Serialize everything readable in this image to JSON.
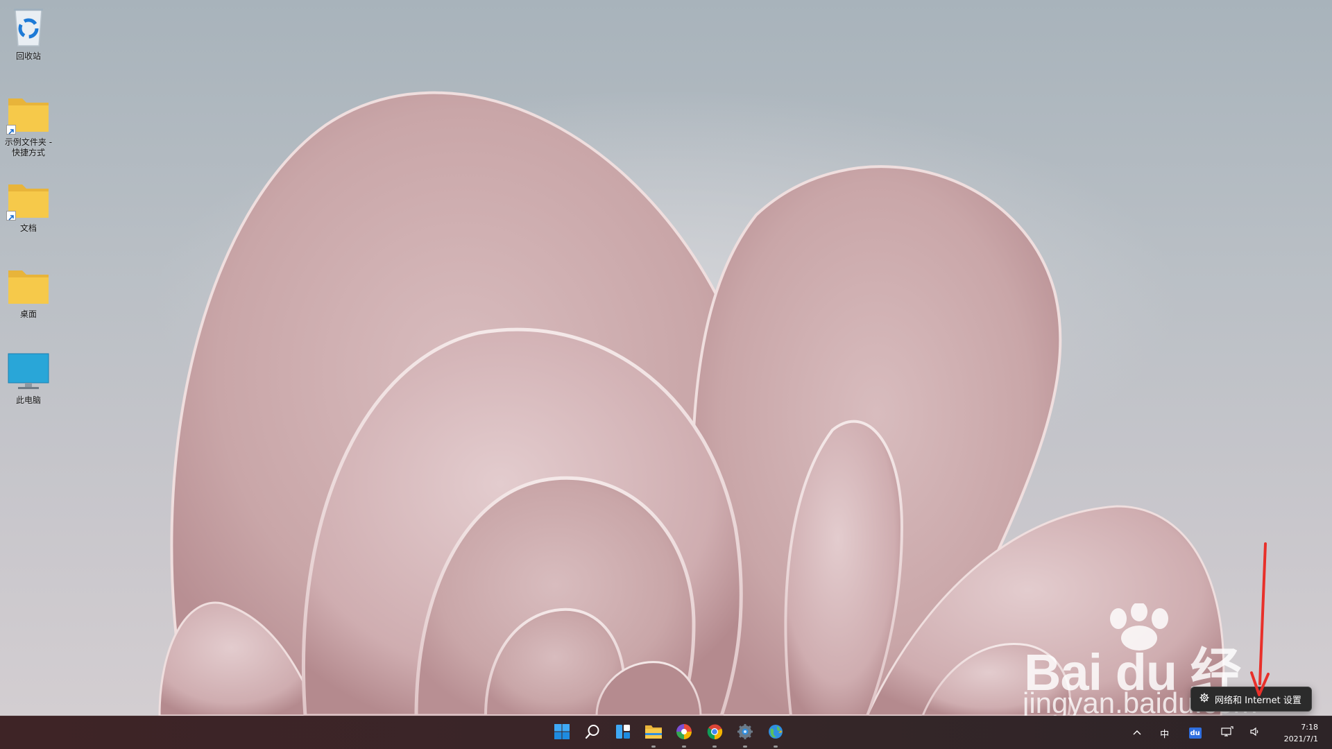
{
  "desktop": {
    "icons": [
      {
        "name": "recycle-bin",
        "label": "回收站"
      },
      {
        "name": "folder-shortcut-example",
        "label": "示例文件夹 - 快捷方式"
      },
      {
        "name": "folder-shortcut-documents",
        "label": "文档"
      },
      {
        "name": "folder-desktop",
        "label": "桌面"
      },
      {
        "name": "this-pc",
        "label": "此电脑"
      }
    ]
  },
  "tooltip": {
    "icon": "gear-icon",
    "text": "网络和 Internet 设置"
  },
  "watermark": {
    "logo": "Bai du 经验",
    "url": "jingyan.baidu.com"
  },
  "taskbar": {
    "apps": [
      {
        "name": "start-button",
        "icon": "windows-logo-icon"
      },
      {
        "name": "search-button",
        "icon": "search-icon"
      },
      {
        "name": "widgets-button",
        "icon": "widgets-icon"
      },
      {
        "name": "file-explorer-button",
        "icon": "folder-icon",
        "running": true
      },
      {
        "name": "app-colorful-button",
        "icon": "color-ball-icon",
        "running": true
      },
      {
        "name": "chrome-button",
        "icon": "chrome-icon",
        "running": true
      },
      {
        "name": "settings-button",
        "icon": "gear-icon",
        "running": true
      },
      {
        "name": "globe-app-button",
        "icon": "globe-icon",
        "running": true
      }
    ],
    "tray": {
      "overflow": "^",
      "ime": "中",
      "baidu": "du",
      "network_icon": "network-icon",
      "volume_icon": "volume-icon"
    },
    "clock": {
      "time": "7:18",
      "date": "2021/7/1"
    }
  },
  "colors": {
    "accent": "#0078d4",
    "folder": "#f6c94a",
    "annotation": "#e8302a"
  }
}
